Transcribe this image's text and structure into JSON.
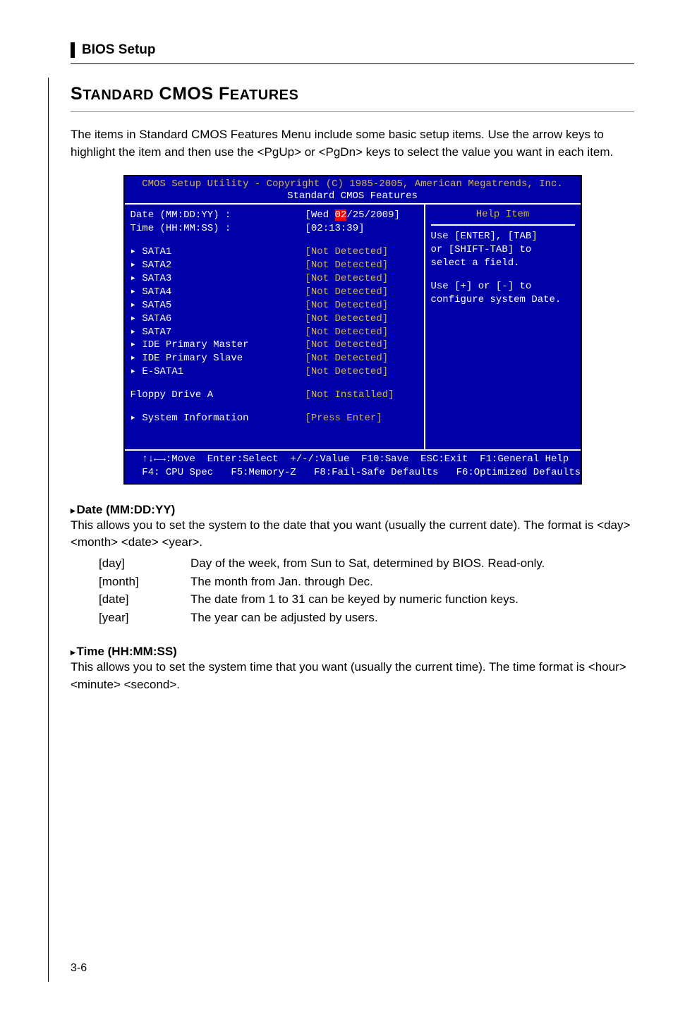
{
  "header": {
    "title": "BIOS Setup"
  },
  "main_title": "Standard CMOS Features",
  "intro": "The items in Standard CMOS Features Menu include some basic setup items. Use the arrow keys to highlight the item and then use the <PgUp> or <PgDn> keys to select the value you want in each item.",
  "bios": {
    "topline": "CMOS Setup Utility - Copyright (C) 1985-2005, American Megatrends, Inc.",
    "subline": "Standard CMOS Features",
    "date_row": {
      "label": "Date (MM:DD:YY) :",
      "prefix": "[Wed ",
      "hl": "02",
      "suffix": "/25/2009]"
    },
    "time_row": {
      "label": "Time (HH:MM:SS) :",
      "value": "[02:13:39]"
    },
    "rows": [
      {
        "label": "▸ SATA1",
        "value": "[Not Detected]"
      },
      {
        "label": "▸ SATA2",
        "value": "[Not Detected]"
      },
      {
        "label": "▸ SATA3",
        "value": "[Not Detected]"
      },
      {
        "label": "▸ SATA4",
        "value": "[Not Detected]"
      },
      {
        "label": "▸ SATA5",
        "value": "[Not Detected]"
      },
      {
        "label": "▸ SATA6",
        "value": "[Not Detected]"
      },
      {
        "label": "▸ SATA7",
        "value": "[Not Detected]"
      },
      {
        "label": "▸ IDE Primary Master",
        "value": "[Not Detected]"
      },
      {
        "label": "▸ IDE Primary Slave",
        "value": "[Not Detected]"
      },
      {
        "label": "▸ E-SATA1",
        "value": "[Not Detected]"
      }
    ],
    "floppy_row": {
      "label": "Floppy Drive A",
      "value": "[Not Installed]"
    },
    "sysinfo_row": {
      "label": "▸ System Information",
      "value": "[Press Enter]"
    },
    "help": {
      "title": "Help Item",
      "line1": "Use [ENTER], [TAB]",
      "line2": "or [SHIFT-TAB] to",
      "line3": "select a field.",
      "line4": "Use [+] or [-] to",
      "line5": "configure system Date."
    },
    "footer1": "  ↑↓←→:Move  Enter:Select  +/-/:Value  F10:Save  ESC:Exit  F1:General Help",
    "footer2": "  F4: CPU Spec   F5:Memory-Z   F8:Fail-Safe Defaults   F6:Optimized Defaults"
  },
  "date_section": {
    "head": "Date (MM:DD:YY)",
    "desc": "This allows you to set the system to the date that you want (usually the current date). The format is <day><month> <date> <year>.",
    "defs": [
      {
        "term": "[day]",
        "desc": "Day of the week, from Sun to Sat, determined by BIOS. Read-only."
      },
      {
        "term": "[month]",
        "desc": "The month from Jan. through Dec."
      },
      {
        "term": "[date]",
        "desc": "The date from 1 to 31 can be keyed by numeric function keys."
      },
      {
        "term": "[year]",
        "desc": "The year can be adjusted by users."
      }
    ]
  },
  "time_section": {
    "head": "Time (HH:MM:SS)",
    "desc": "This allows you to set the system time that you want (usually the current time). The time format is <hour> <minute> <second>."
  },
  "page_num": "3-6"
}
